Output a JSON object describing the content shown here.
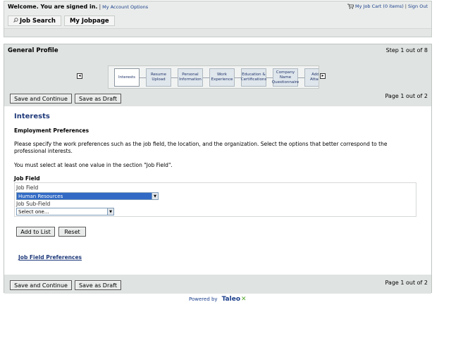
{
  "header": {
    "welcome": "Welcome. You are signed in.",
    "account_options": "My Account Options",
    "job_cart": "My Job Cart (0 items)",
    "sign_out": "Sign Out",
    "tabs": [
      {
        "label": "Job Search",
        "icon": "search-icon"
      },
      {
        "label": "My Jobpage"
      }
    ]
  },
  "profile": {
    "title": "General Profile",
    "step": "Step 1 out of 8",
    "page_top": "Page 1 out of 2",
    "page_bottom": "Page 1 out of 2"
  },
  "wizard": {
    "prev_icon": "arrow-left-icon",
    "next_icon": "arrow-right-icon",
    "steps": [
      {
        "label": "Interests",
        "active": true
      },
      {
        "label": "Resume Upload"
      },
      {
        "label": "Personal Information"
      },
      {
        "label": "Work Experience"
      },
      {
        "label": "Education & Certifications"
      },
      {
        "label": "Company Name Questionnaire"
      },
      {
        "label": "Additi Attachr"
      }
    ]
  },
  "buttons": {
    "save_continue": "Save and Continue",
    "save_draft": "Save as Draft",
    "add_to_list": "Add to List",
    "reset": "Reset"
  },
  "content": {
    "heading": "Interests",
    "subheading": "Employment Preferences",
    "paragraph1": "Please specify the work preferences such as the job field, the location, and the organization. Select the options that better correspond to the professional interests.",
    "paragraph2": "You must select at least one value in the section \"Job Field\".",
    "job_field_section": "Job Field",
    "job_field_label": "Job Field",
    "job_field_value": "Human Resources",
    "job_subfield_label": "Job Sub-Field",
    "job_subfield_value": "Select one...",
    "preferences_link": "Job Field Preferences"
  },
  "footer": {
    "powered_by": "Powered by",
    "brand": "Taleo"
  },
  "colors": {
    "accent": "#1f3a7a",
    "selection": "#316ac5",
    "panel_bg": "#dfe3e1"
  }
}
